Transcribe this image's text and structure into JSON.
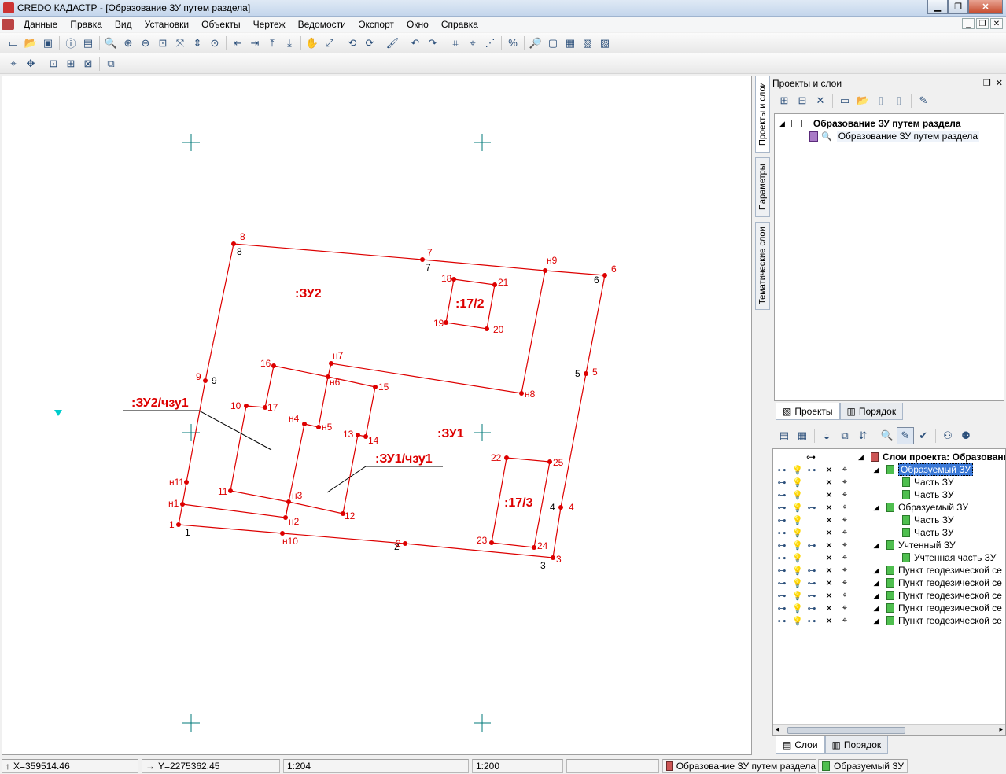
{
  "window": {
    "title": "CREDO КАДАСТР - [Образование ЗУ путем раздела]"
  },
  "menu": [
    "Данные",
    "Правка",
    "Вид",
    "Установки",
    "Объекты",
    "Чертеж",
    "Ведомости",
    "Экспорт",
    "Окно",
    "Справка"
  ],
  "panel": {
    "title": "Проекты и слои",
    "vertical_tabs": [
      "Проекты и слои",
      "Параметры",
      "Тематические слои"
    ],
    "tree": {
      "group": "Образование ЗУ путем раздела",
      "item": "Образование ЗУ путем раздела"
    },
    "tabs_top": [
      "Проекты",
      "Порядок"
    ],
    "layers_root": "Слои проекта: Образовани",
    "layers": [
      {
        "name": "Образуемый ЗУ",
        "level": 1,
        "selected": true
      },
      {
        "name": "Часть ЗУ",
        "level": 2
      },
      {
        "name": "Часть ЗУ",
        "level": 2
      },
      {
        "name": "Образуемый ЗУ",
        "level": 1
      },
      {
        "name": "Часть ЗУ",
        "level": 2
      },
      {
        "name": "Часть ЗУ",
        "level": 2
      },
      {
        "name": "Учтенный ЗУ",
        "level": 1
      },
      {
        "name": "Учтенная часть ЗУ",
        "level": 2
      },
      {
        "name": "Пункт геодезической се",
        "level": 1
      },
      {
        "name": "Пункт геодезической се",
        "level": 1
      },
      {
        "name": "Пункт геодезической се",
        "level": 1
      },
      {
        "name": "Пункт геодезической се",
        "level": 1
      },
      {
        "name": "Пункт геодезической се",
        "level": 1
      }
    ],
    "tabs_bottom": [
      "Слои",
      "Порядок"
    ]
  },
  "drawing": {
    "parcel_labels": [
      ":ЗУ2",
      ":17/2",
      ":ЗУ1",
      ":17/3"
    ],
    "part_labels": [
      ":ЗУ2/чзу1",
      ":ЗУ1/чзу1"
    ],
    "red_point_labels": [
      "1",
      "2",
      "3",
      "4",
      "5",
      "6",
      "7",
      "8",
      "9",
      "н1",
      "н2",
      "н3",
      "н4",
      "н5",
      "н6",
      "н7",
      "н8",
      "н9",
      "н10",
      "н11",
      "10",
      "11",
      "12",
      "13",
      "14",
      "15",
      "16",
      "17",
      "18",
      "19",
      "20",
      "21",
      "22",
      "23",
      "24",
      "25"
    ],
    "black_point_labels": [
      "1",
      "2",
      "3",
      "4",
      "5",
      "6",
      "7",
      "8",
      "9"
    ],
    "colors": {
      "boundary": "#dd0000",
      "label_red": "#dd0000",
      "grid_cross": "#007878",
      "marker": "#00cccc"
    }
  },
  "status": {
    "x": "X=359514.46",
    "y": "Y=2275362.45",
    "scale1": "1:204",
    "scale2": "1:200",
    "project": "Образование ЗУ путем раздела",
    "layer": "Образуемый ЗУ"
  }
}
